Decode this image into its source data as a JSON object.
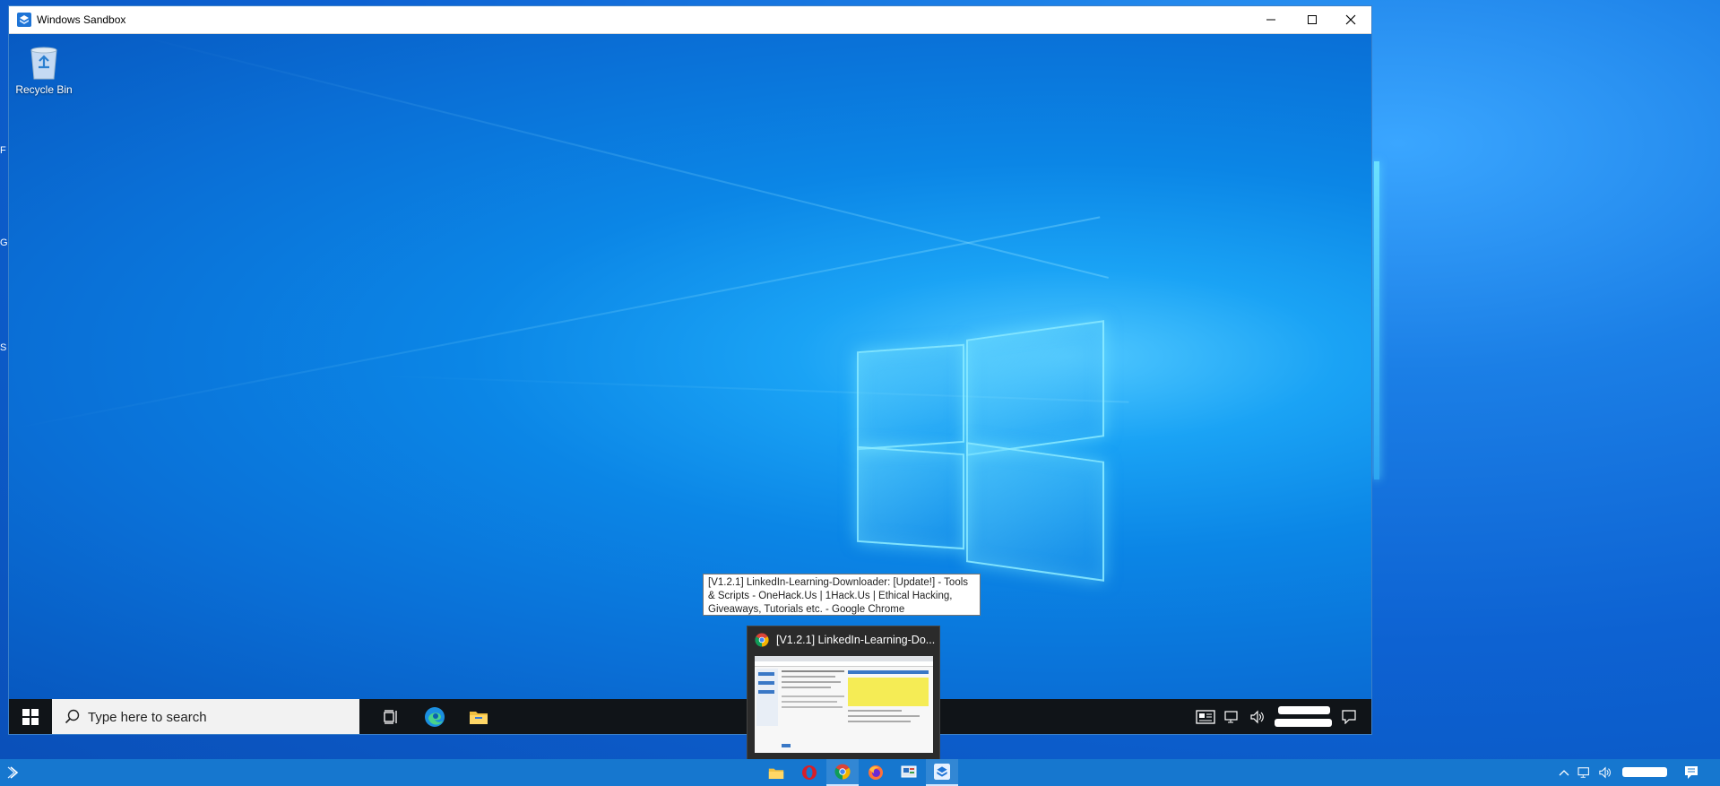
{
  "host": {
    "desktop_edge_letters": [
      "F",
      "G",
      "S"
    ],
    "taskbar": {
      "icons": [
        "powershell-icon",
        "file-explorer-icon",
        "opera-icon",
        "chrome-icon",
        "firefox-icon",
        "control-panel-icon",
        "windows-sandbox-icon"
      ],
      "active_icon": "chrome-icon"
    }
  },
  "window": {
    "title": "Windows Sandbox",
    "controls": [
      "minimize",
      "maximize",
      "close"
    ]
  },
  "guest": {
    "desktop_icons": [
      {
        "label": "Recycle Bin",
        "icon": "recycle-bin-icon"
      }
    ],
    "taskbar": {
      "search_placeholder": "Type here to search",
      "icons": [
        "task-view-icon",
        "edge-icon",
        "file-explorer-icon"
      ]
    }
  },
  "tooltip": {
    "text": "[V1.2.1] LinkedIn-Learning-Downloader: [Update!] - Tools & Scripts - OneHack.Us | 1Hack.Us | Ethical Hacking, Giveaways, Tutorials etc. - Google Chrome"
  },
  "thumbnail": {
    "title": "[V1.2.1] LinkedIn-Learning-Do..."
  },
  "colors": {
    "accent": "#0a6fd6",
    "taskbar_dark": "#101418",
    "host_taskbar": "#1677cf"
  }
}
